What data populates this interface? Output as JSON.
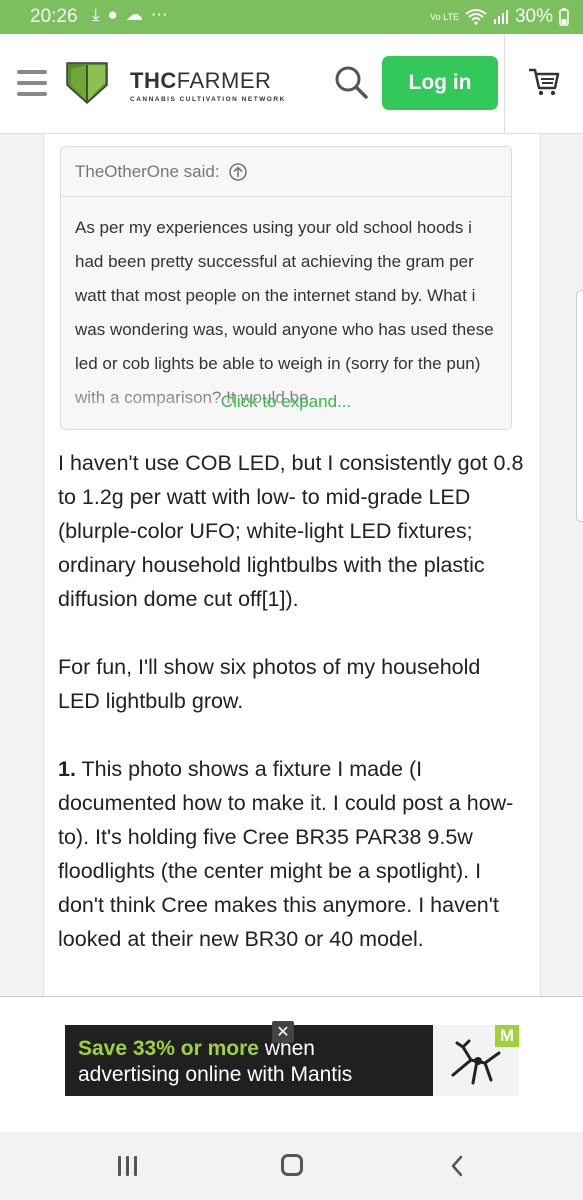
{
  "status_bar": {
    "time": "20:26",
    "left_icons": [
      "download-done-icon",
      "android-icon",
      "cloud-icon",
      "more-icon"
    ],
    "lte_label": "Vo LTE",
    "battery": "30%"
  },
  "header": {
    "logo_bold": "THC",
    "logo_rest": "FARMER",
    "tagline": "CANNABIS CULTIVATION NETWORK",
    "login_label": "Log in",
    "accent_color": "#34c759"
  },
  "quote": {
    "author": "TheOtherOne said:",
    "body": "As per my experiences using your old school hoods i had been pretty successful at achieving the gram per watt that most people on the internet stand by. What i was wondering was, would anyone who has used these led or cob lights be able to weigh in (sorry for the pun) with a comparison? It would be",
    "expand_label": "Click to expand..."
  },
  "post": {
    "para1": "I haven't use COB LED, but I consistently got 0.8 to 1.2g per watt with low- to mid-grade LED (blurple-color UFO; white-light LED fixtures; ordinary household lightbulbs with the plastic diffusion dome cut off[1]).",
    "para2": "For fun, I'll show six photos of my household LED lightbulb grow.",
    "para3_num": "1.",
    "para3": " This photo shows a fixture I made (I documented how to make it. I could post a how-to). It's holding five Cree BR35 PAR38 9.5w floodlights (the center might be a spotlight). I don't think Cree makes this anymore. I haven't looked at their new BR30 or 40 model."
  },
  "ad": {
    "highlight": "Save 33% or more",
    "line1_rest": " when",
    "line2": "advertising online with Mantis",
    "badge": "M",
    "close_label": "✕"
  }
}
